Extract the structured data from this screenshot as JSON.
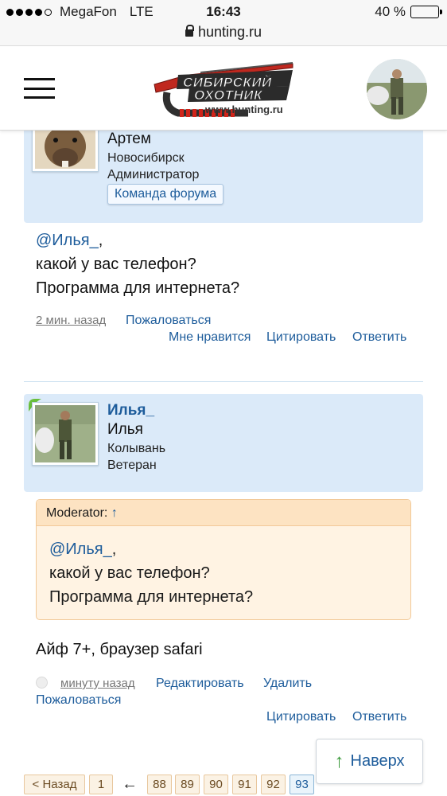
{
  "status_bar": {
    "carrier": "MegaFon",
    "network": "LTE",
    "time": "16:43",
    "battery": "40 %",
    "battery_level": 0.4
  },
  "url_bar": {
    "url": "hunting.ru"
  },
  "header": {
    "logo_line1": "СИБИРСКИЙ",
    "logo_line2": "ОХОТНИК",
    "logo_url": "www.hunting.ru"
  },
  "post1": {
    "author_name": "Артем",
    "location": "Новосибирск",
    "rank": "Администратор",
    "badge": "Команда форума",
    "mention": "@Илья_",
    "mention_suffix": ",",
    "line1": "какой у вас телефон?",
    "line2": "Программа для интернета?",
    "time": "2 мин. назад",
    "report": "Пожаловаться",
    "like": "Мне нравится",
    "quote": "Цитировать",
    "reply": "Ответить"
  },
  "post2": {
    "username": "Илья_",
    "author_name": "Илья",
    "location": "Колывань",
    "rank": "Ветеран",
    "quote_header": "Moderator:",
    "quote_arrow": "↑",
    "quote_mention": "@Илья_",
    "quote_mention_suffix": ",",
    "quote_line1": "какой у вас телефон?",
    "quote_line2": "Программа для интернета?",
    "message": "Айф 7+, браузер safari",
    "time": "минуту назад",
    "edit": "Редактировать",
    "delete": "Удалить",
    "report": "Пожаловаться",
    "quote": "Цитировать",
    "reply": "Ответить"
  },
  "to_top": {
    "label": "Наверх",
    "arrow": "↑"
  },
  "pagination": {
    "prev": "< Назад",
    "first": "1",
    "ellipsis_arrow": "←",
    "pages": [
      "88",
      "89",
      "90",
      "91",
      "92"
    ],
    "current": "93"
  },
  "colors": {
    "link": "#1d5c9b",
    "card_bg": "#dbeaf9",
    "quote_bg": "#fff3e3",
    "quote_border": "#f2c998"
  }
}
